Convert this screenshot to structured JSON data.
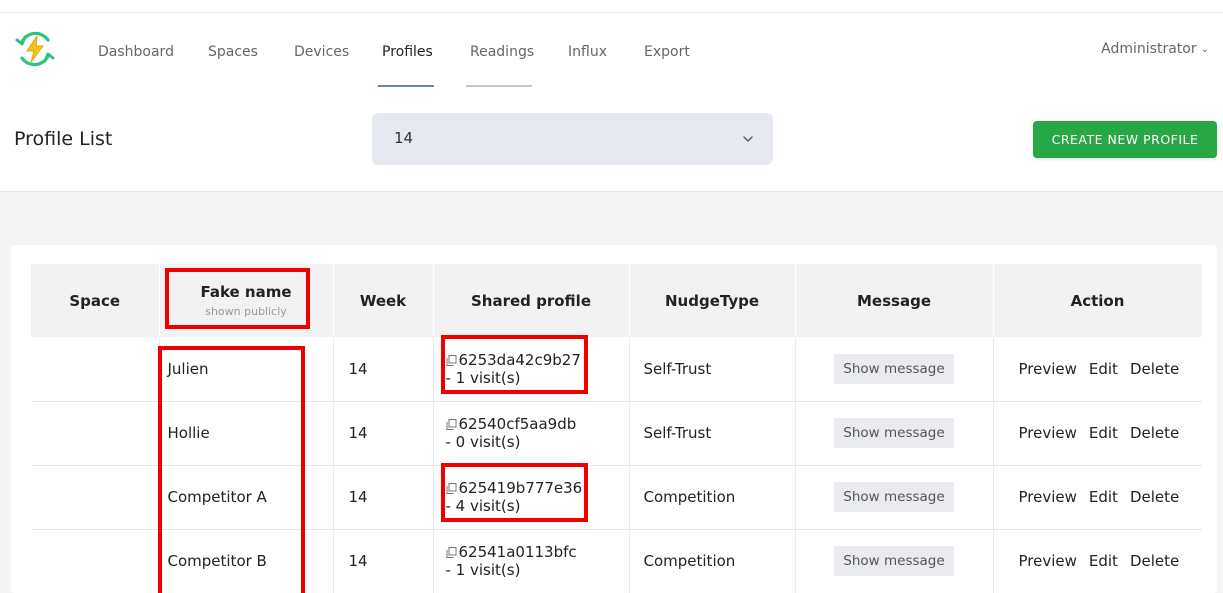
{
  "nav": {
    "items": [
      "Dashboard",
      "Spaces",
      "Devices",
      "Profiles",
      "Readings",
      "Influx",
      "Export"
    ],
    "active": "Profiles",
    "user": "Administrator"
  },
  "header": {
    "title": "Profile List",
    "week_select": "14",
    "create_label": "CREATE NEW PROFILE"
  },
  "table": {
    "headers": {
      "space": "Space",
      "fake_name": "Fake name",
      "fake_name_sub": "shown publicly",
      "week": "Week",
      "shared": "Shared profile",
      "nudge": "NudgeType",
      "message": "Message",
      "action": "Action"
    },
    "rows": [
      {
        "space": "",
        "name": "Julien",
        "week": "14",
        "shared_id": "6253da42c9b27",
        "visits": "- 1 visit(s)",
        "nudge": "Self-Trust",
        "message_btn": "Show message",
        "preview": "Preview",
        "edit": "Edit",
        "delete": "Delete"
      },
      {
        "space": "",
        "name": "Hollie",
        "week": "14",
        "shared_id": "62540cf5aa9db",
        "visits": "- 0 visit(s)",
        "nudge": "Self-Trust",
        "message_btn": "Show message",
        "preview": "Preview",
        "edit": "Edit",
        "delete": "Delete"
      },
      {
        "space": "",
        "name": "Competitor A",
        "week": "14",
        "shared_id": "625419b777e36",
        "visits": "- 4 visit(s)",
        "nudge": "Competition",
        "message_btn": "Show message",
        "preview": "Preview",
        "edit": "Edit",
        "delete": "Delete"
      },
      {
        "space": "",
        "name": "Competitor B",
        "week": "14",
        "shared_id": "62541a0113bfc",
        "visits": "- 1 visit(s)",
        "nudge": "Competition",
        "message_btn": "Show message",
        "preview": "Preview",
        "edit": "Edit",
        "delete": "Delete"
      }
    ]
  },
  "colors": {
    "accent_nav": "#6b7fd1",
    "create_button": "#28a745",
    "annotation": "#ee0000",
    "logo_green": "#2ec27e",
    "logo_yellow": "#f5c518"
  },
  "icons": [
    "app-logo-icon",
    "chevron-down-icon",
    "copy-icon"
  ]
}
